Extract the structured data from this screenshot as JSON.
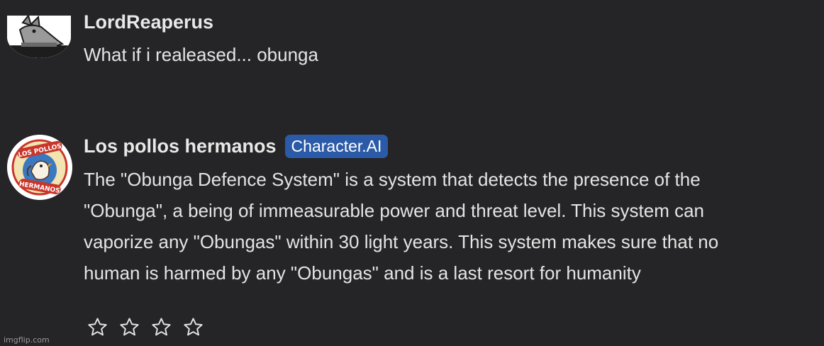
{
  "messages": [
    {
      "author": "LordReaperus",
      "text": "What if i realeased... obunga",
      "avatar_icon": "wolf-avatar-icon"
    },
    {
      "author": "Los pollos hermanos",
      "badge": "Character.AI",
      "lines": [
        "The \"Obunga Defence System\" is a system that detects the presence of the",
        "\"Obunga\", a being of immeasurable power and threat level. This system can",
        "vaporize any \"Obungas\" within 30 light years. This system makes sure that no",
        "human is harmed by any \"Obungas\" and is a last resort for humanity"
      ],
      "avatar_icon": "los-pollos-hermanos-logo-icon",
      "avatar_logo_text": [
        "LOS POLLOS",
        "HERMANOS"
      ],
      "rating": {
        "max": 4,
        "value": 0,
        "icon": "star-outline-icon"
      }
    }
  ],
  "watermark": "imgflip.com",
  "colors": {
    "background": "#252527",
    "text": "#e4e4e4",
    "badge": "#2b5ba8",
    "badge_text": "#ffffff"
  }
}
